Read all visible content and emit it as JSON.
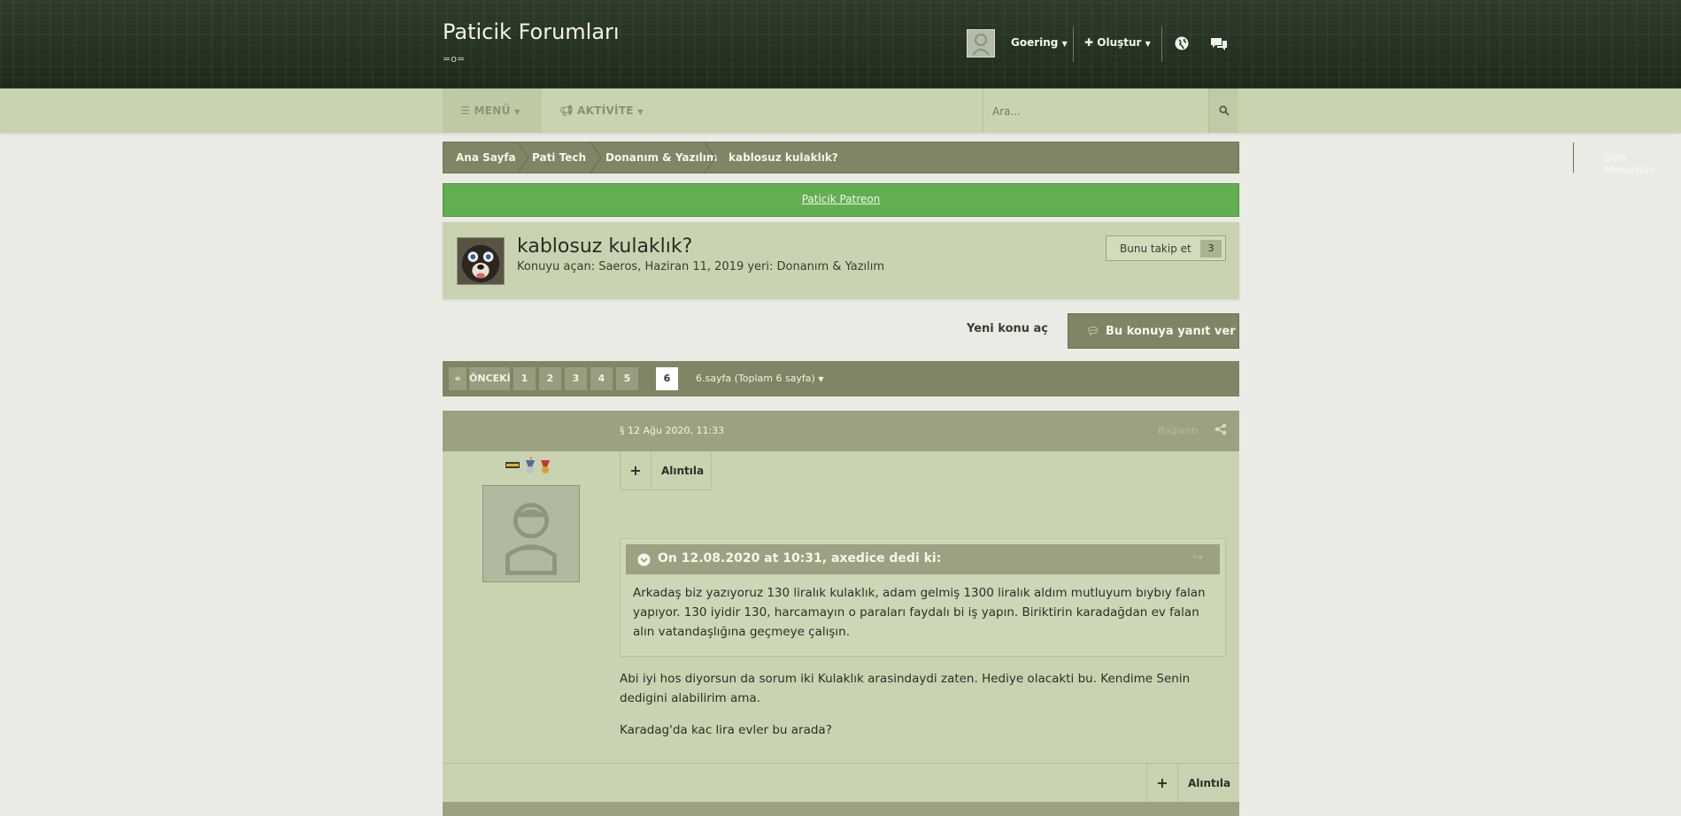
{
  "site": {
    "title": "Paticik Forumları",
    "subtitle": "=o="
  },
  "header": {
    "username": "Goering",
    "create_label": "Oluştur"
  },
  "nav": {
    "menu_label": "MENÜ",
    "activity_label": "AKTİVİTE",
    "search_placeholder": "Ara..."
  },
  "breadcrumb": {
    "items": [
      "Ana Sayfa",
      "Pati Tech",
      "Donanım & Yazılım",
      "kablosuz kulaklık?"
    ],
    "recent_label": "Son Mesajlar"
  },
  "banner": {
    "text": "Paticik Patreon",
    "color": "#63ad52"
  },
  "thread": {
    "title": "kablosuz kulaklık?",
    "meta": "Konuyu açan: Saeros, Haziran 11, 2019 yeri: Donanım & Yazılım",
    "follow_label": "Bunu takip et",
    "follow_count": "3"
  },
  "actions": {
    "new_topic": "Yeni konu aç",
    "reply": "Bu konuya yanıt ver"
  },
  "pagination": {
    "prev_arrow": "«",
    "prev_label": "ÖNCEKİ",
    "pages": [
      "1",
      "2",
      "3",
      "4",
      "5",
      "6"
    ],
    "current_page": "6",
    "info": "6.sayfa (Toplam 6 sayfa)"
  },
  "post": {
    "date": "§ 12 Ağu 2020, 11:33",
    "share_label": "Bağlantı",
    "plus_label": "+",
    "quote_label": "Alıntıla",
    "quote_author": "On 12.08.2020 at 10:31, axedice dedi ki:",
    "quote_text": "Arkadaş biz yazıyoruz 130 liralık kulaklık, adam gelmiş 1300 liralık aldım mutluyum bıybıy falan yapıyor. 130 iyidir 130, harcamayın o paraları faydalı bi iş yapın. Biriktirin karadağdan ev falan alın vatandaşlığına geçmeye çalışın.",
    "body": [
      "Abi iyi hos diyorsun da sorum iki Kulaklık arasindaydi zaten. Hediye olacakti bu. Kendime Senin dedigini alabilirim ama.",
      "Karadag'da kac lira evler bu arada?"
    ]
  },
  "colors": {
    "header_bg": "#25321f",
    "nav_bg": "#c9d3b1",
    "accent": "#7f8565",
    "page_bg": "#ebebe5"
  }
}
